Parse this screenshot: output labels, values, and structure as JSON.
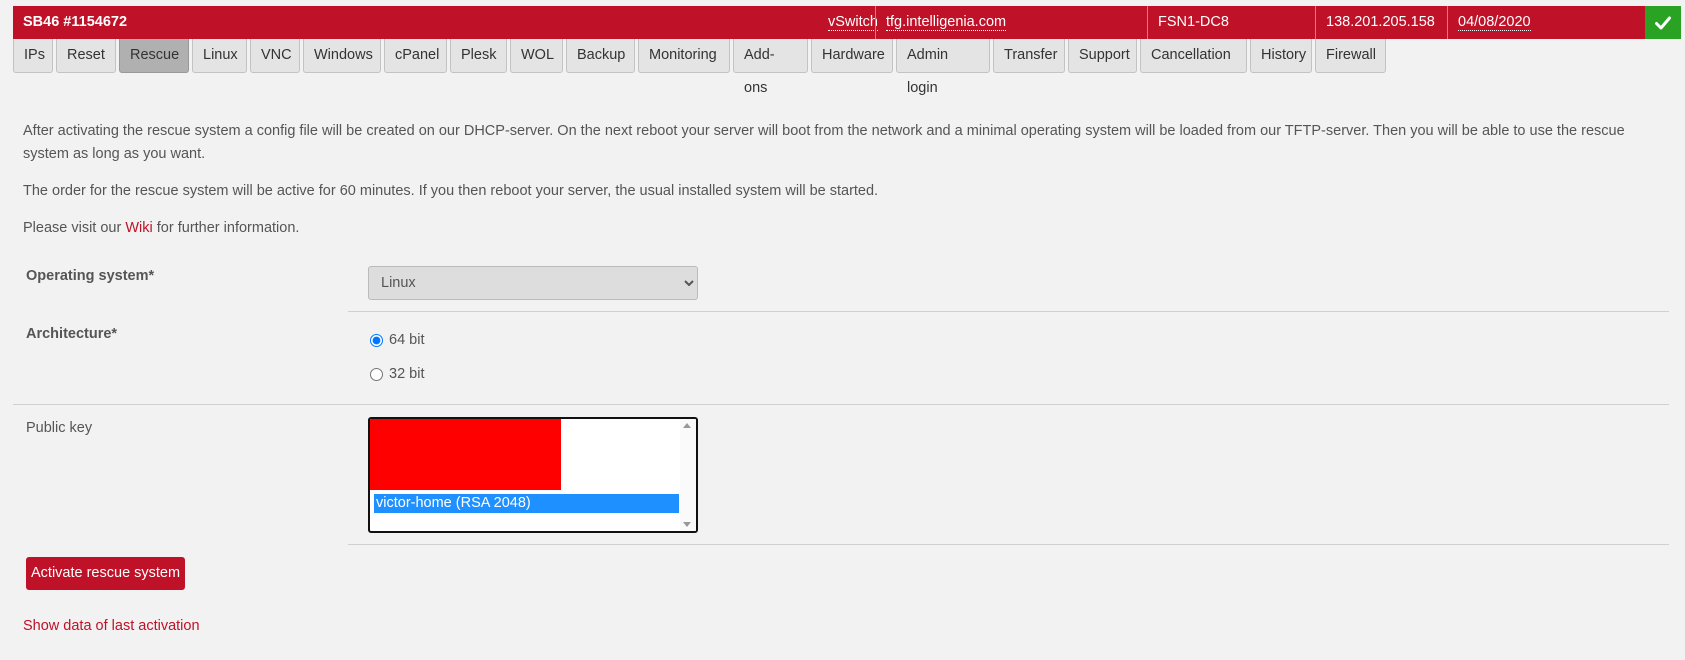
{
  "header": {
    "title": "SB46 #1154672",
    "vswitch": "vSwitch",
    "hostname": "tfg.intelligenia.com",
    "location": "FSN1-DC8",
    "ip": "138.201.205.158",
    "date": "04/08/2020",
    "status_icon": "check-icon",
    "status_color": "#2aa325",
    "accent_color": "#bf1128"
  },
  "tabs": [
    {
      "label": "IPs"
    },
    {
      "label": "Reset"
    },
    {
      "label": "Rescue",
      "active": true
    },
    {
      "label": "Linux"
    },
    {
      "label": "VNC"
    },
    {
      "label": "Windows"
    },
    {
      "label": "cPanel"
    },
    {
      "label": "Plesk"
    },
    {
      "label": "WOL"
    },
    {
      "label": "Backup"
    },
    {
      "label": "Monitoring"
    },
    {
      "label": "Add-ons"
    },
    {
      "label": "Hardware"
    },
    {
      "label": "Admin login"
    },
    {
      "label": "Transfer"
    },
    {
      "label": "Support"
    },
    {
      "label": "Cancellation"
    },
    {
      "label": "History"
    },
    {
      "label": "Firewall"
    }
  ],
  "intro": {
    "p1": "After activating the rescue system a config file will be created on our DHCP-server. On the next reboot your server will boot from the network and a minimal operating system will be loaded from our TFTP-server. Then you will be able to use the rescue system as long as you want.",
    "p2": "The order for the rescue system will be active for 60 minutes. If you then reboot your server, the usual installed system will be started.",
    "p3_before": "Please visit our ",
    "p3_link": "Wiki",
    "p3_after": " for further information."
  },
  "form": {
    "os_label": "Operating system*",
    "os_value": "Linux",
    "arch_label": "Architecture*",
    "arch_options": [
      {
        "label": "64 bit",
        "checked": true
      },
      {
        "label": "32 bit",
        "checked": false
      }
    ],
    "pubkey_label": "Public key",
    "pubkey_selected": "victor-home (RSA 2048)",
    "activate_button": "Activate rescue system",
    "last_activation_link": "Show data of last activation"
  }
}
